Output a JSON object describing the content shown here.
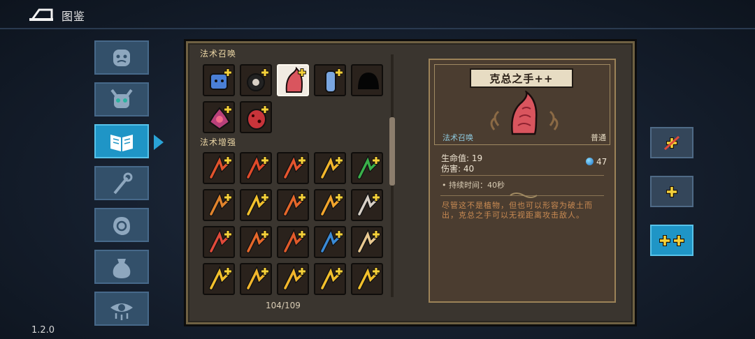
{
  "header": {
    "title": "图鉴",
    "version": "1.2.0"
  },
  "categories": [
    {
      "icon": "demon-face-icon",
      "active": false
    },
    {
      "icon": "horned-skull-icon",
      "active": false
    },
    {
      "icon": "open-book-icon",
      "active": true
    },
    {
      "icon": "magic-staff-icon",
      "active": false
    },
    {
      "icon": "spell-hand-icon",
      "active": false
    },
    {
      "icon": "pouch-icon",
      "active": false
    },
    {
      "icon": "eye-icon",
      "active": false
    }
  ],
  "grid": {
    "section_summon": "法术召唤",
    "section_enhance": "法术增强",
    "counter": "104/109",
    "summon_items": [
      {
        "icon": "blue-cube-summon-icon",
        "color": "#4a7fd6"
      },
      {
        "icon": "black-bomb-summon-icon",
        "color": "#d8d0c6"
      },
      {
        "icon": "flesh-tentacle-summon-icon",
        "color": "#d9555e",
        "selected": true
      },
      {
        "icon": "blue-canister-summon-icon",
        "color": "#7aa6e0"
      },
      {
        "icon": "locked-silhouette-icon",
        "color": "#000000"
      },
      {
        "icon": "purple-flower-summon-icon",
        "color": "#b8407a"
      },
      {
        "icon": "red-egg-summon-icon",
        "color": "#c8343a"
      }
    ],
    "enhance_items": [
      {
        "icon": "triple-arrow-red-icon",
        "color": "#e0532c"
      },
      {
        "icon": "double-claw-red-icon",
        "color": "#e04a2a"
      },
      {
        "icon": "fan-burst-red-icon",
        "color": "#e5552e"
      },
      {
        "icon": "gold-blob-icon",
        "color": "#f2b62c"
      },
      {
        "icon": "green-drop-icon",
        "color": "#3ab04a"
      },
      {
        "icon": "orbit-target-icon",
        "color": "#e0832c"
      },
      {
        "icon": "zigzag-lightning-icon",
        "color": "#f2c02c"
      },
      {
        "icon": "pause-orb-icon",
        "color": "#e5672a"
      },
      {
        "icon": "crescent-moon-icon",
        "color": "#f2a52c"
      },
      {
        "icon": "mouse-device-icon",
        "color": "#d8d0c6"
      },
      {
        "icon": "target-reticle-icon",
        "color": "#e04a3a"
      },
      {
        "icon": "rising-trend-icon",
        "color": "#e5672a"
      },
      {
        "icon": "split-arrows-icon",
        "color": "#e05a2a"
      },
      {
        "icon": "blue-wing-icon",
        "color": "#3a8ad6"
      },
      {
        "icon": "larva-icon",
        "color": "#e8c890"
      },
      {
        "icon": "gold-bolt-icon",
        "color": "#f2c02c"
      },
      {
        "icon": "gold-up-arrows-icon",
        "color": "#f2b62c"
      },
      {
        "icon": "gold-ring-burst-icon",
        "color": "#f2b62c"
      },
      {
        "icon": "gold-card-icon",
        "color": "#f2c02c"
      },
      {
        "icon": "gold-grid-icon",
        "color": "#f2c02c"
      }
    ]
  },
  "detail": {
    "name": "克总之手++",
    "category": "法术召唤",
    "rarity": "普通",
    "hp": "生命值: 19",
    "damage": "伤害: 40",
    "cost": "47",
    "duration": "• 持续时间：40秒",
    "description": "尽管这不是植物，但也可以形容为破土而出，克总之手可以无视距离攻击敌人。",
    "accent_color": "#d9555e"
  },
  "filters": [
    {
      "icon": "no-upgrade-icon",
      "active": false
    },
    {
      "icon": "single-plus-icon",
      "active": false
    },
    {
      "icon": "double-plus-icon",
      "active": true
    }
  ]
}
